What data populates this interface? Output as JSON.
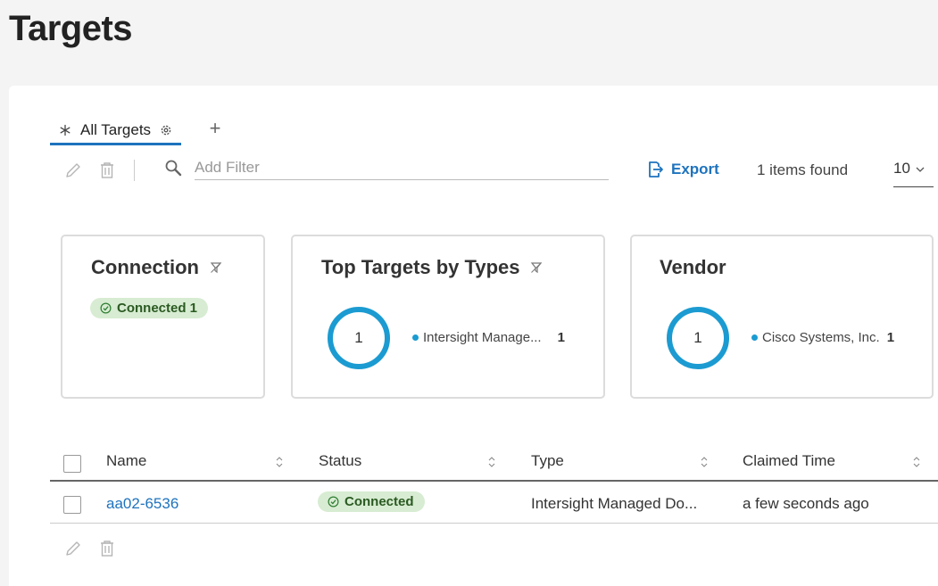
{
  "page": {
    "title": "Targets"
  },
  "tabs": [
    {
      "label": "All Targets"
    }
  ],
  "toolbar": {
    "filter_placeholder": "Add Filter",
    "export_label": "Export",
    "items_found": "1 items found",
    "page_size": "10"
  },
  "cards": {
    "connection": {
      "title": "Connection",
      "badge": "Connected 1"
    },
    "top_types": {
      "title": "Top Targets by Types",
      "donut_value": "1",
      "legend_label": "Intersight Manage...",
      "legend_count": "1"
    },
    "vendor": {
      "title": "Vendor",
      "donut_value": "1",
      "legend_label": "Cisco Systems, Inc.",
      "legend_count": "1"
    }
  },
  "table": {
    "columns": [
      "Name",
      "Status",
      "Type",
      "Claimed Time"
    ],
    "rows": [
      {
        "name": "aa02-6536",
        "status": "Connected",
        "type": "Intersight Managed Do...",
        "claimed": "a few seconds ago"
      }
    ]
  },
  "colors": {
    "accent": "#1e73be",
    "donut": "#1b9bd1",
    "connected_bg": "#d7ecd2"
  },
  "icons": {
    "tab": "asterisk-icon",
    "tab_settings": "gear-icon",
    "tab_add": "plus-icon",
    "edit": "pencil-icon",
    "delete": "trash-icon",
    "search": "search-icon",
    "export": "export-icon",
    "filter": "funnel-icon",
    "status": "check-circle-icon"
  }
}
